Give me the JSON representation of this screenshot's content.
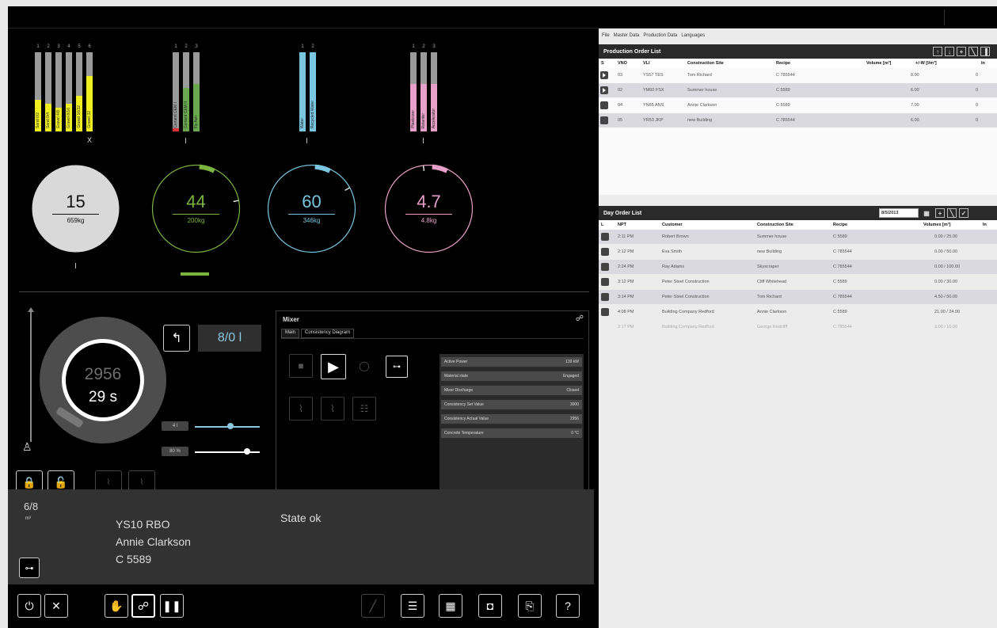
{
  "menu": [
    "File",
    "Master Data",
    "Production Data",
    "Languages"
  ],
  "silo_groups": [
    {
      "nums": [
        "1",
        "2",
        "3",
        "4",
        "5",
        "6"
      ],
      "bars": [
        {
          "fill": 0.4,
          "color": "#f0f020",
          "label": "Sand 0/2"
        },
        {
          "fill": 0.35,
          "color": "#f0f020",
          "label": "Sand 0/4"
        },
        {
          "fill": 0.3,
          "color": "#f0f020",
          "label": "Gravel 4/8"
        },
        {
          "fill": 0.35,
          "color": "#f0f020",
          "label": "Gravel 8/16"
        },
        {
          "fill": 0.45,
          "color": "#f0f020",
          "label": "Gravel 16/32"
        },
        {
          "fill": 0.7,
          "color": "#f0f020",
          "label": "Gravel 32"
        }
      ],
      "mark": "X"
    },
    {
      "nums": [
        "1",
        "2",
        "3"
      ],
      "bars": [
        {
          "fill": 0.04,
          "color": "#d33",
          "label": "Cement CEM I"
        },
        {
          "fill": 0.55,
          "color": "#6aa84f",
          "label": "Cement CEM II"
        },
        {
          "fill": 0.6,
          "color": "#6aa84f",
          "label": "Fly Ash"
        }
      ],
      "mark": ""
    },
    {
      "nums": [
        "1",
        "2"
      ],
      "bars": [
        {
          "fill": 1.0,
          "color": "#7ac6e0",
          "label": "Water"
        },
        {
          "fill": 1.0,
          "color": "#7ac6e0",
          "label": "Recycled Water"
        }
      ],
      "mark": ""
    },
    {
      "nums": [
        "1",
        "2",
        "3"
      ],
      "bars": [
        {
          "fill": 0.6,
          "color": "#e7a0c8",
          "label": "Plasticizer"
        },
        {
          "fill": 0.6,
          "color": "#e7a0c8",
          "label": "Retarder"
        },
        {
          "fill": 0.6,
          "color": "#e7a0c8",
          "label": "Accelerator"
        }
      ],
      "mark": ""
    }
  ],
  "gauges": [
    {
      "value": "15",
      "sub": "659kg",
      "color": "#d9d9d9",
      "filled": true,
      "level": 0.0
    },
    {
      "value": "44",
      "sub": "200kg",
      "color": "#7bb341",
      "filled": false,
      "level": 0.22
    },
    {
      "value": "60",
      "sub": "346kg",
      "color": "#7ac6e0",
      "filled": false,
      "level": 0.17
    },
    {
      "value": "4.7",
      "sub": "4.8kg",
      "color": "#e7a0c8",
      "filled": false,
      "level": 0.98
    }
  ],
  "dial": {
    "value1": "2956",
    "value2": "29 s"
  },
  "volume": "8/0 l",
  "sliders": [
    {
      "badge": "4 l",
      "level": 0.55,
      "color": "#8cc7e0"
    },
    {
      "badge": "80 %",
      "level": 0.8,
      "color": "#fff"
    }
  ],
  "mixer": {
    "title": "Mixer",
    "tabs": [
      "Main",
      "Consistency Diagram"
    ],
    "rows": [
      {
        "label": "Active Power",
        "value": "139 kW"
      },
      {
        "label": "Material state",
        "value": "Engaged"
      },
      {
        "label": "Mixer Discharge",
        "value": "Closed"
      },
      {
        "label": "Consistency Set Value",
        "value": "3000"
      },
      {
        "label": "Consistency Actual Value",
        "value": "2956"
      },
      {
        "label": "Concrete Temperature",
        "value": "0 °C"
      }
    ]
  },
  "info": {
    "fraction": "6/8",
    "unit": "m³",
    "vehicle": "YS10 RBO",
    "customer": "Annie Clarkson",
    "recipe": "C 5589",
    "state": "State ok"
  },
  "production": {
    "title": "Production Order List",
    "headers": [
      "S",
      "VNO",
      "VLI",
      "Construction Site",
      "Recipe",
      "Volume [m³]",
      "+/-W [l/m³]",
      "In"
    ],
    "rows": [
      {
        "vno": "03",
        "vli": "YS57 TES",
        "site": "Tom Richard",
        "recipe": "C 785544",
        "volume": "8.00",
        "w": "0",
        "icon": "play"
      },
      {
        "vno": "02",
        "vli": "YM60 FSX",
        "site": "Summer house",
        "recipe": "C 5589",
        "volume": "6.00",
        "w": "0",
        "icon": "play"
      },
      {
        "vno": "04",
        "vli": "YN65 ANS",
        "site": "Annie Clarkson",
        "recipe": "C 5589",
        "volume": "7.00",
        "w": "0",
        "icon": "sq"
      },
      {
        "vno": "05",
        "vli": "YR53 JKP",
        "site": "new Building",
        "recipe": "C 785544",
        "volume": "6.00",
        "w": "0",
        "icon": "sq"
      }
    ]
  },
  "day": {
    "title": "Day Order List",
    "date": "8/5/2013",
    "headers": [
      "L",
      "NPT",
      "Customer",
      "Construction Site",
      "Recipe",
      "Volumes [m³]",
      "In"
    ],
    "rows": [
      {
        "npt": "2:11 PM",
        "customer": "Robert Brown",
        "site": "Summer house",
        "recipe": "C 5589",
        "volume": "0.00 / 25.00",
        "faded": false
      },
      {
        "npt": "2:12 PM",
        "customer": "Eva Smith",
        "site": "new Building",
        "recipe": "C 785544",
        "volume": "0.00 / 50.00",
        "faded": false
      },
      {
        "npt": "2:24 PM",
        "customer": "Ray Adams",
        "site": "Skyscraper",
        "recipe": "C 785544",
        "volume": "0.00 / 100.00",
        "faded": false
      },
      {
        "npt": "3:12 PM",
        "customer": "Peter Steel Construction",
        "site": "Cliff Whitehead",
        "recipe": "C 5589",
        "volume": "0.00 / 30.00",
        "faded": false
      },
      {
        "npt": "3:14 PM",
        "customer": "Peter Steel Construction",
        "site": "Tom Richard",
        "recipe": "C 785544",
        "volume": "4.50 / 50.00",
        "faded": false
      },
      {
        "npt": "4:08 PM",
        "customer": "Building Company Redford",
        "site": "Annie Clarkson",
        "recipe": "C 5589",
        "volume": "21.00 / 24.00",
        "faded": false
      },
      {
        "npt": "2:17 PM",
        "customer": "Building Company Redford",
        "site": "George Redcliff",
        "recipe": "C 785544",
        "volume": "3.00 / 10.00",
        "faded": true
      }
    ]
  },
  "bottom_icons": [
    "power-icon",
    "cancel-icon",
    "hand-icon",
    "link-icon",
    "pause-icon",
    "wrench-icon",
    "checklist-icon",
    "grid-icon",
    "component-icon",
    "door-icon",
    "help-icon"
  ],
  "bottom_glyphs": [
    "⏻",
    "✕",
    "✋",
    "☍",
    "❚❚",
    "╱",
    "☰",
    "▦",
    "◘",
    "⎘",
    "?"
  ]
}
